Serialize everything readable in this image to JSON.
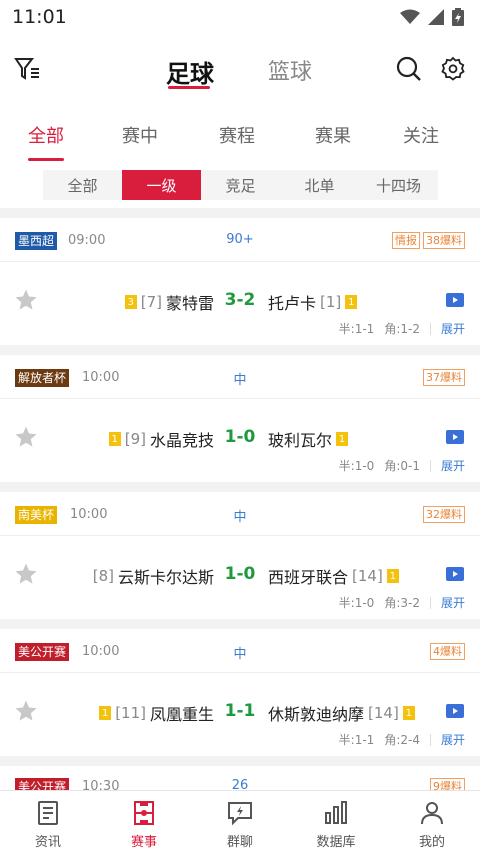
{
  "status_bar": {
    "time": "11:01"
  },
  "header": {
    "sport_tabs": [
      {
        "label": "足球",
        "active": true
      },
      {
        "label": "篮球",
        "active": false
      }
    ]
  },
  "status_tabs": [
    {
      "label": "全部",
      "active": true
    },
    {
      "label": "赛中"
    },
    {
      "label": "赛程"
    },
    {
      "label": "赛果"
    },
    {
      "label": "关注"
    }
  ],
  "levels": [
    {
      "label": "全部"
    },
    {
      "label": "一级",
      "active": true
    },
    {
      "label": "竞足"
    },
    {
      "label": "北单"
    },
    {
      "label": "十四场"
    }
  ],
  "matches": [
    {
      "league": "墨西超",
      "league_color": "#1f5aa8",
      "time": "09:00",
      "status": "90+",
      "tags": [
        "情报",
        "38爆料"
      ],
      "home_badge": "3",
      "home_rank": "[7]",
      "home": "蒙特雷",
      "score": "3-2",
      "away": "托卢卡",
      "away_rank": "[1]",
      "away_badge": "1",
      "half": "半:1-1",
      "corner": "角:1-2",
      "expand": "展开"
    },
    {
      "league": "解放者杯",
      "league_color": "#6b3a10",
      "time": "10:00",
      "status": "中",
      "tags": [
        "37爆料"
      ],
      "home_badge": "1",
      "home_rank": "[9]",
      "home": "水晶竞技",
      "score": "1-0",
      "away": "玻利瓦尔",
      "away_rank": "",
      "away_badge": "1",
      "half": "半:1-0",
      "corner": "角:0-1",
      "expand": "展开"
    },
    {
      "league": "南美杯",
      "league_color": "#e8b400",
      "time": "10:00",
      "status": "中",
      "tags": [
        "32爆料"
      ],
      "home_badge": "",
      "home_rank": "[8]",
      "home": "云斯卡尔达斯",
      "score": "1-0",
      "away": "西班牙联合",
      "away_rank": "[14]",
      "away_badge": "1",
      "half": "半:1-0",
      "corner": "角:3-2",
      "expand": "展开"
    },
    {
      "league": "美公开赛",
      "league_color": "#c01e2a",
      "time": "10:00",
      "status": "中",
      "tags": [
        "4爆料"
      ],
      "home_badge": "1",
      "home_rank": "[11]",
      "home": "凤凰重生",
      "score": "1-1",
      "away": "休斯敦迪纳摩",
      "away_rank": "[14]",
      "away_badge": "1",
      "half": "半:1-1",
      "corner": "角:2-4",
      "expand": "展开"
    },
    {
      "league": "美公开赛",
      "league_color": "#c01e2a",
      "time": "10:30",
      "status": "26",
      "tags": [
        "9爆料"
      ]
    }
  ],
  "bottom_nav": [
    {
      "label": "资讯",
      "icon": "news-icon"
    },
    {
      "label": "赛事",
      "icon": "pitch-icon",
      "active": true
    },
    {
      "label": "群聊",
      "icon": "chat-icon"
    },
    {
      "label": "数据库",
      "icon": "chart-icon"
    },
    {
      "label": "我的",
      "icon": "user-icon"
    }
  ],
  "colors": {
    "accent": "#d81e3c",
    "score": "#1e9a3c",
    "link": "#3a7bd5"
  }
}
